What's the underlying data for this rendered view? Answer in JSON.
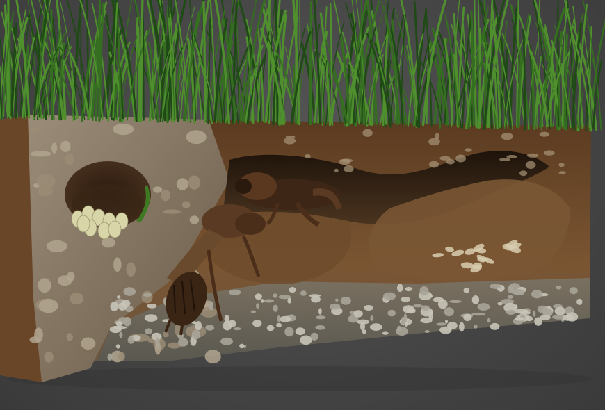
{
  "scene": {
    "description_visible_text": "",
    "colors": {
      "background": "#4a4a4a",
      "soil_dark": "#3b2a1a",
      "soil_mid": "#6b4a2c",
      "soil_light": "#8a6a48",
      "stone_face": "#7a6a55",
      "gravel": "#9a9a95",
      "grass_dark": "#1f4a16",
      "grass_light": "#4f8f2e",
      "egg": "#d8d6a8",
      "cricket": "#4a2e1a"
    },
    "objects": {
      "grass": "grass-layer",
      "soil": "soil-block",
      "burrow": "burrow-tunnel",
      "eggs": "egg-clutch",
      "crickets": [
        "mole-cricket-upper",
        "mole-cricket-lower"
      ],
      "larvae": "nymph-cluster"
    }
  }
}
